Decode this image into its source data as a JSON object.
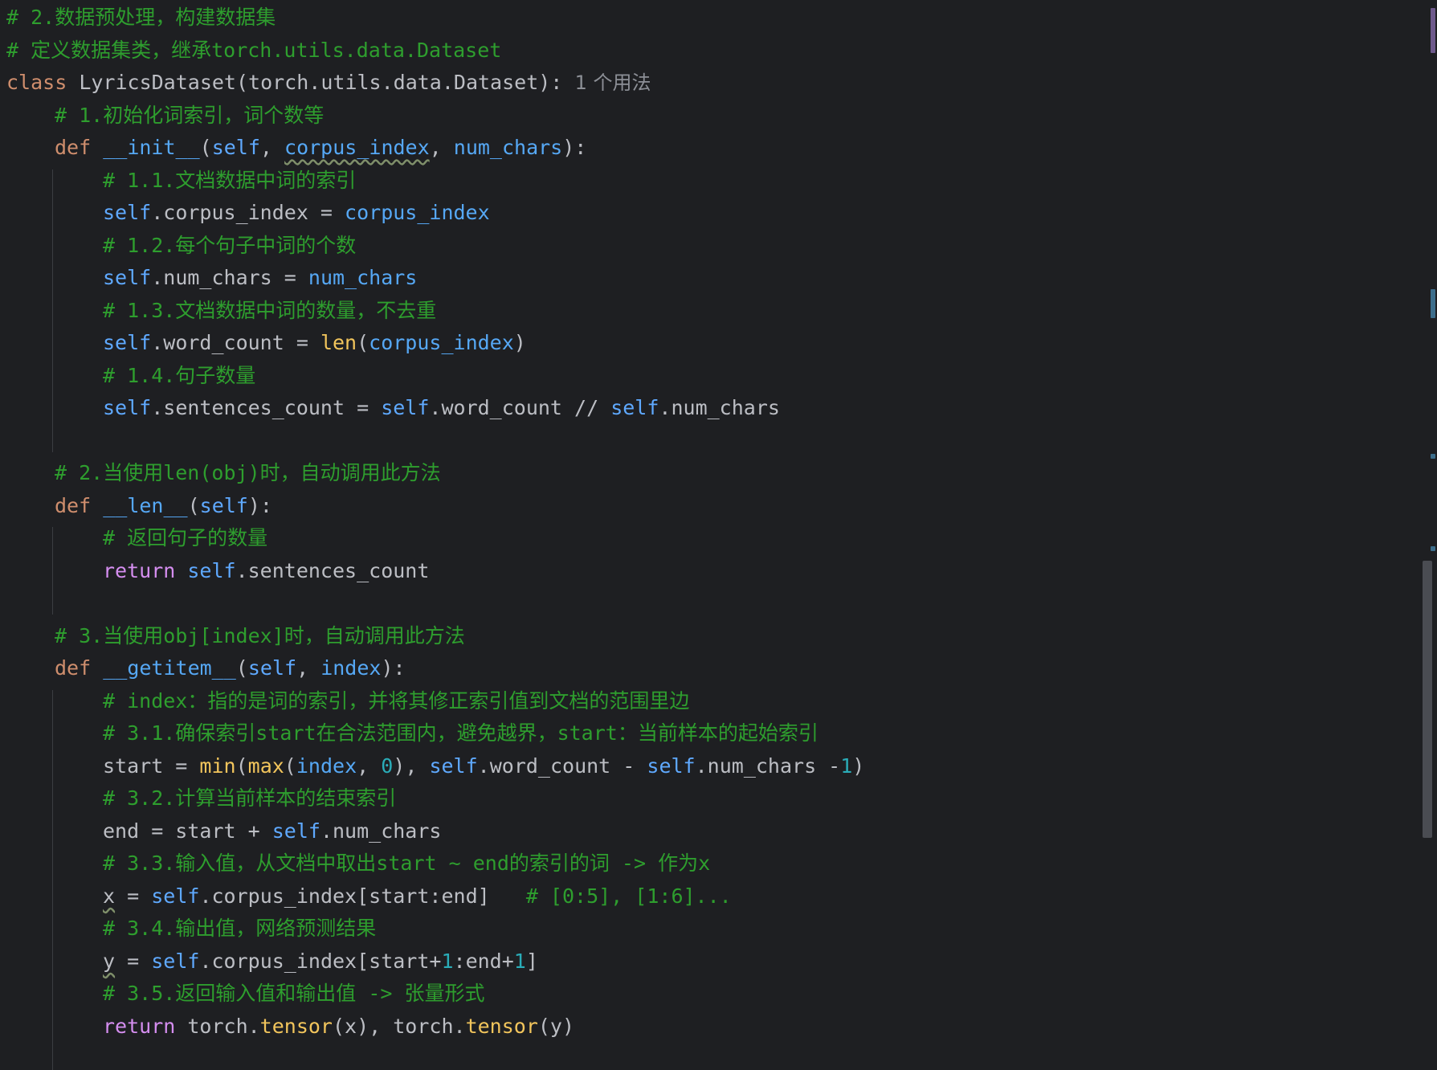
{
  "editor": {
    "lines": [
      {
        "indent": 0,
        "tokens": [
          {
            "t": "cmt",
            "v": "# 2.数据预处理，构建数据集"
          }
        ]
      },
      {
        "indent": 0,
        "tokens": [
          {
            "t": "cmt",
            "v": "# 定义数据集类，继承torch.utils.data.Dataset"
          }
        ]
      },
      {
        "indent": 0,
        "tokens": [
          {
            "t": "kw",
            "v": "class "
          },
          {
            "t": "plain",
            "v": "LyricsDataset(torch.utils.data.Dataset):"
          },
          {
            "t": "hint",
            "v": "  1 个用法"
          }
        ]
      },
      {
        "indent": 1,
        "tokens": [
          {
            "t": "cmt",
            "v": "# 1.初始化词索引，词个数等"
          }
        ]
      },
      {
        "indent": 1,
        "tokens": [
          {
            "t": "kw",
            "v": "def "
          },
          {
            "t": "fn",
            "v": "__init__"
          },
          {
            "t": "plain",
            "v": "("
          },
          {
            "t": "selfb",
            "v": "self"
          },
          {
            "t": "plain",
            "v": ", "
          },
          {
            "t": "param",
            "v": "corpus_index",
            "wavy": true
          },
          {
            "t": "plain",
            "v": ", "
          },
          {
            "t": "param",
            "v": "num_chars"
          },
          {
            "t": "plain",
            "v": "):"
          }
        ]
      },
      {
        "indent": 2,
        "tokens": [
          {
            "t": "cmt",
            "v": "# 1.1.文档数据中词的索引"
          }
        ]
      },
      {
        "indent": 2,
        "tokens": [
          {
            "t": "selfb",
            "v": "self"
          },
          {
            "t": "plain",
            "v": ".corpus_index = "
          },
          {
            "t": "param",
            "v": "corpus_index"
          }
        ]
      },
      {
        "indent": 2,
        "tokens": [
          {
            "t": "cmt",
            "v": "# 1.2.每个句子中词的个数"
          }
        ]
      },
      {
        "indent": 2,
        "tokens": [
          {
            "t": "selfb",
            "v": "self"
          },
          {
            "t": "plain",
            "v": ".num_chars = "
          },
          {
            "t": "param",
            "v": "num_chars"
          }
        ]
      },
      {
        "indent": 2,
        "tokens": [
          {
            "t": "cmt",
            "v": "# 1.3.文档数据中词的数量，不去重"
          }
        ]
      },
      {
        "indent": 2,
        "tokens": [
          {
            "t": "selfb",
            "v": "self"
          },
          {
            "t": "plain",
            "v": ".word_count = "
          },
          {
            "t": "builtin",
            "v": "len"
          },
          {
            "t": "plain",
            "v": "("
          },
          {
            "t": "param",
            "v": "corpus_index"
          },
          {
            "t": "plain",
            "v": ")"
          }
        ]
      },
      {
        "indent": 2,
        "tokens": [
          {
            "t": "cmt",
            "v": "# 1.4.句子数量"
          }
        ]
      },
      {
        "indent": 2,
        "tokens": [
          {
            "t": "selfb",
            "v": "self"
          },
          {
            "t": "plain",
            "v": ".sentences_count = "
          },
          {
            "t": "selfb",
            "v": "self"
          },
          {
            "t": "plain",
            "v": ".word_count // "
          },
          {
            "t": "selfb",
            "v": "self"
          },
          {
            "t": "plain",
            "v": ".num_chars"
          }
        ]
      },
      {
        "indent": 0,
        "tokens": []
      },
      {
        "indent": 1,
        "tokens": [
          {
            "t": "cmt",
            "v": "# 2.当使用len(obj)时，自动调用此方法"
          }
        ]
      },
      {
        "indent": 1,
        "tokens": [
          {
            "t": "kw",
            "v": "def "
          },
          {
            "t": "fn",
            "v": "__len__"
          },
          {
            "t": "plain",
            "v": "("
          },
          {
            "t": "selfb",
            "v": "self"
          },
          {
            "t": "plain",
            "v": "):"
          }
        ]
      },
      {
        "indent": 2,
        "tokens": [
          {
            "t": "cmt",
            "v": "# 返回句子的数量"
          }
        ]
      },
      {
        "indent": 2,
        "tokens": [
          {
            "t": "kw2",
            "v": "return "
          },
          {
            "t": "selfb",
            "v": "self"
          },
          {
            "t": "plain",
            "v": ".sentences_count"
          }
        ]
      },
      {
        "indent": 0,
        "tokens": []
      },
      {
        "indent": 1,
        "tokens": [
          {
            "t": "cmt",
            "v": "# 3.当使用obj[index]时，自动调用此方法"
          }
        ]
      },
      {
        "indent": 1,
        "tokens": [
          {
            "t": "kw",
            "v": "def "
          },
          {
            "t": "fn",
            "v": "__getitem__"
          },
          {
            "t": "plain",
            "v": "("
          },
          {
            "t": "selfb",
            "v": "self"
          },
          {
            "t": "plain",
            "v": ", "
          },
          {
            "t": "param",
            "v": "index"
          },
          {
            "t": "plain",
            "v": "):"
          }
        ]
      },
      {
        "indent": 2,
        "tokens": [
          {
            "t": "cmt",
            "v": "# index：指的是词的索引，并将其修正索引值到文档的范围里边"
          }
        ]
      },
      {
        "indent": 2,
        "tokens": [
          {
            "t": "cmt",
            "v": "# 3.1.确保索引start在合法范围内，避免越界，start：当前样本的起始索引"
          }
        ]
      },
      {
        "indent": 2,
        "tokens": [
          {
            "t": "plain",
            "v": "start = "
          },
          {
            "t": "builtin",
            "v": "min"
          },
          {
            "t": "plain",
            "v": "("
          },
          {
            "t": "builtin",
            "v": "max"
          },
          {
            "t": "plain",
            "v": "("
          },
          {
            "t": "param",
            "v": "index"
          },
          {
            "t": "plain",
            "v": ", "
          },
          {
            "t": "num",
            "v": "0"
          },
          {
            "t": "plain",
            "v": "), "
          },
          {
            "t": "selfb",
            "v": "self"
          },
          {
            "t": "plain",
            "v": ".word_count - "
          },
          {
            "t": "selfb",
            "v": "self"
          },
          {
            "t": "plain",
            "v": ".num_chars -"
          },
          {
            "t": "num",
            "v": "1"
          },
          {
            "t": "plain",
            "v": ")"
          }
        ]
      },
      {
        "indent": 2,
        "tokens": [
          {
            "t": "cmt",
            "v": "# 3.2.计算当前样本的结束索引"
          }
        ]
      },
      {
        "indent": 2,
        "tokens": [
          {
            "t": "plain",
            "v": "end = start + "
          },
          {
            "t": "selfb",
            "v": "self"
          },
          {
            "t": "plain",
            "v": ".num_chars"
          }
        ]
      },
      {
        "indent": 2,
        "tokens": [
          {
            "t": "cmt",
            "v": "# 3.3.输入值，从文档中取出start ~ end的索引的词 -> 作为x"
          }
        ]
      },
      {
        "indent": 2,
        "tokens": [
          {
            "t": "plain",
            "v": "x",
            "wavy": true
          },
          {
            "t": "plain",
            "v": " = "
          },
          {
            "t": "selfb",
            "v": "self"
          },
          {
            "t": "plain",
            "v": ".corpus_index[start:end]   "
          },
          {
            "t": "cmt",
            "v": "# [0:5], [1:6]..."
          }
        ]
      },
      {
        "indent": 2,
        "tokens": [
          {
            "t": "cmt",
            "v": "# 3.4.输出值，网络预测结果"
          }
        ]
      },
      {
        "indent": 2,
        "tokens": [
          {
            "t": "plain",
            "v": "y",
            "wavy": true
          },
          {
            "t": "plain",
            "v": " = "
          },
          {
            "t": "selfb",
            "v": "self"
          },
          {
            "t": "plain",
            "v": ".corpus_index[start+"
          },
          {
            "t": "num",
            "v": "1"
          },
          {
            "t": "plain",
            "v": ":end+"
          },
          {
            "t": "num",
            "v": "1"
          },
          {
            "t": "plain",
            "v": "]"
          }
        ]
      },
      {
        "indent": 2,
        "tokens": [
          {
            "t": "cmt",
            "v": "# 3.5.返回输入值和输出值 -> 张量形式"
          }
        ]
      },
      {
        "indent": 2,
        "tokens": [
          {
            "t": "kw2",
            "v": "return "
          },
          {
            "t": "plain",
            "v": "torch."
          },
          {
            "t": "builtin",
            "v": "tensor"
          },
          {
            "t": "plain",
            "v": "(x), torch."
          },
          {
            "t": "builtin",
            "v": "tensor"
          },
          {
            "t": "plain",
            "v": "(y)"
          }
        ]
      }
    ]
  },
  "colors": {
    "background": "#1e1f22",
    "comment": "#2e9e2e",
    "keyword": "#cf8e6d",
    "self": "#5fa9ff",
    "builtin": "#f2c55c",
    "number": "#2aacb8"
  }
}
